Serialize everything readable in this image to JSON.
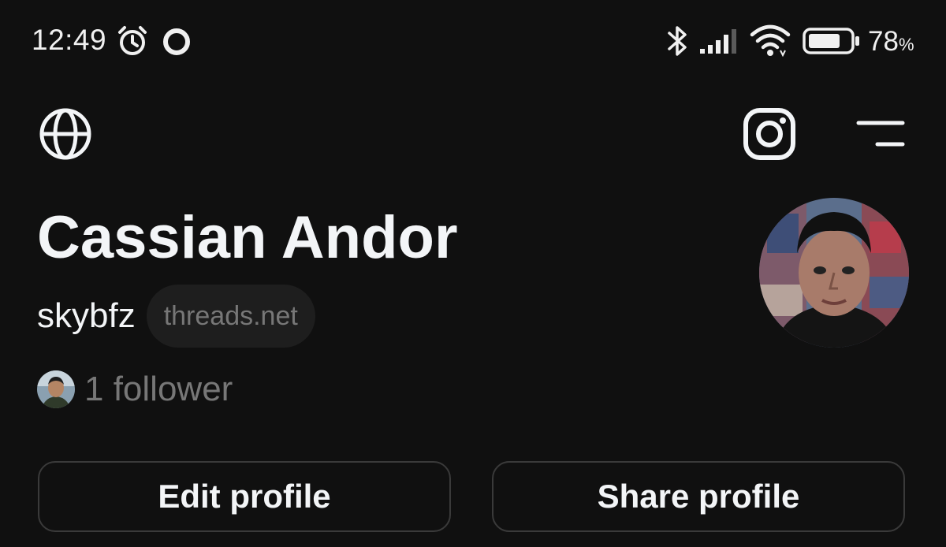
{
  "status_bar": {
    "time": "12:49",
    "battery_percent": "78",
    "battery_unit": "%",
    "battery_level": 0.78,
    "icons": [
      "alarm-icon",
      "circle-notification-icon",
      "bluetooth-icon",
      "signal-icon",
      "wifi-icon",
      "battery-icon"
    ]
  },
  "nav": {
    "left_icon": "globe-icon",
    "right_icons": [
      "instagram-icon",
      "menu-icon"
    ]
  },
  "profile": {
    "name": "Cassian Andor",
    "handle": "skybfz",
    "domain_badge": "threads.net",
    "followers_text": "1 follower"
  },
  "actions": {
    "edit_label": "Edit profile",
    "share_label": "Share profile"
  },
  "colors": {
    "background": "#101010",
    "primary_text": "#f3f5f7",
    "secondary_text": "#777777",
    "border": "#3a3a3a",
    "pill_bg": "#1e1e1e"
  }
}
